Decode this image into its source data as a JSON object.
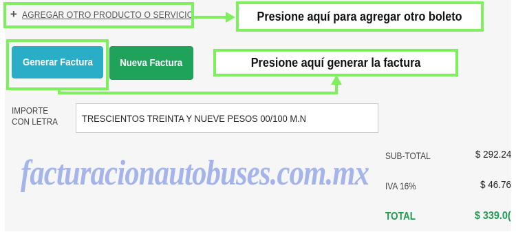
{
  "add_product": {
    "icon": "plus-icon",
    "label": "AGREGAR OTRO PRODUCTO O SERVICIO"
  },
  "callouts": {
    "add_ticket": "Presione aquí para agregar otro boleto",
    "generate_invoice": "Presione aquí generar la factura"
  },
  "buttons": {
    "generate": "Generar Factura",
    "new": "Nueva Factura"
  },
  "importe": {
    "label": "IMPORTE CON LETRA",
    "value": "TRESCIENTOS TREINTA Y NUEVE PESOS 00/100 M.N"
  },
  "watermark": "facturacionautobuses.com.mx",
  "summary": {
    "subtotal_label": "SUB-TOTAL",
    "subtotal_value": "$ 292.24",
    "iva_label": "IVA 16%",
    "iva_value": "$ 46.76",
    "total_label": "TOTAL",
    "total_value": "$ 339.0("
  },
  "colors": {
    "highlight": "#7ef05e",
    "generate_button": "#2aaec8",
    "new_button": "#1fa25a",
    "total_green": "#1f9a4f",
    "watermark": "#8fa2e6"
  }
}
